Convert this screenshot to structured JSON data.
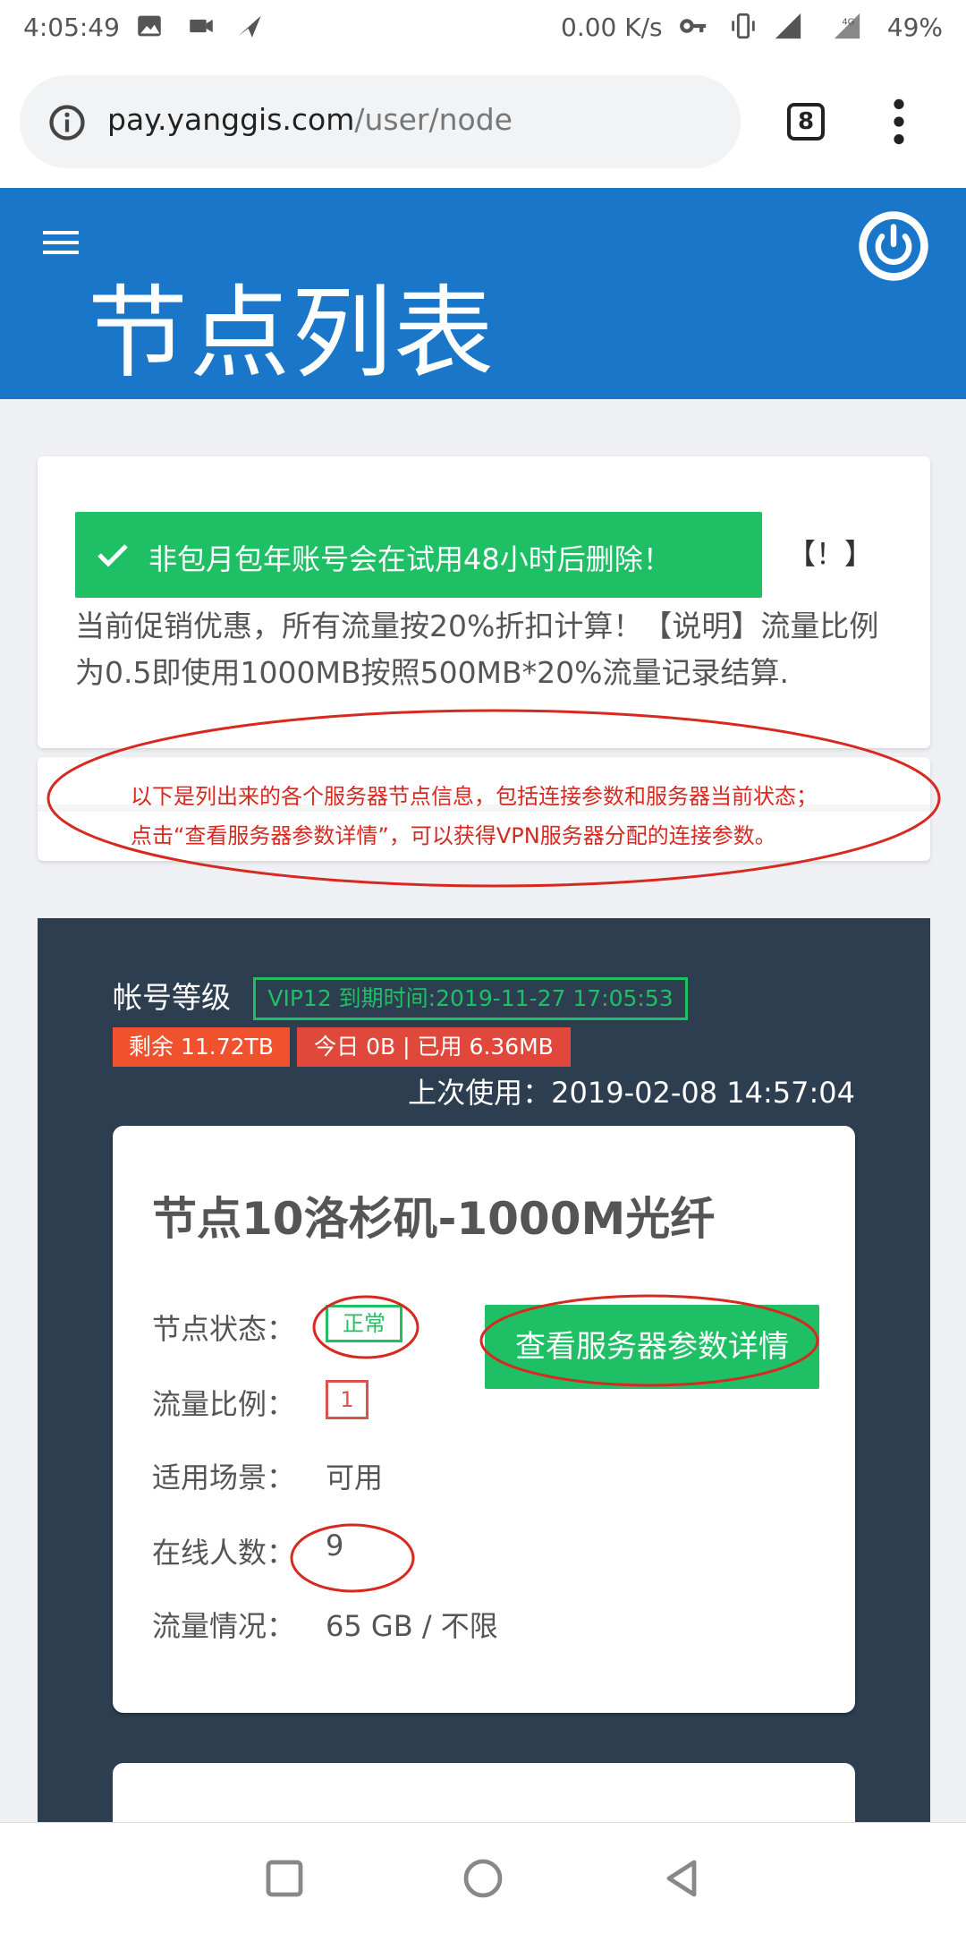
{
  "status_bar": {
    "time": "4:05:49",
    "net_speed": "0.00 K/s",
    "network_badge": "4G",
    "network_badge_sub": "1X",
    "battery": "49%",
    "icons": [
      "image-icon",
      "video-camera-icon",
      "send-icon",
      "key-icon",
      "vibrate-icon",
      "signal-icon",
      "signal-icon",
      "battery-icon"
    ]
  },
  "browser": {
    "url_host": "pay.yanggis.com",
    "url_path": "/user/node",
    "tab_count": "8"
  },
  "header": {
    "title": "节点列表"
  },
  "notice": {
    "alert": "非包月包年账号会在试用48小时后删除！",
    "exclaim": "【！】",
    "promo": "当前促销优惠，所有流量按20%折扣计算！【说明】流量比例为0.5即使用1000MB按照500MB*20%流量记录结算."
  },
  "info": {
    "line1": "以下是列出来的各个服务器节点信息，包括连接参数和服务器当前状态；",
    "line2": "点击“查看服务器参数详情”，可以获得VPN服务器分配的连接参数。"
  },
  "account": {
    "level_label": "帐号等级",
    "vip_badge": "VIP12 到期时间:2019-11-27 17:05:53",
    "remaining": "剩余 11.72TB",
    "usage": "今日 0B | 已用 6.36MB",
    "last_used": "上次使用：2019-02-08 14:57:04"
  },
  "node": {
    "title": "节点10洛杉矶-1000M光纤",
    "status_label": "节点状态：",
    "status_value": "正常",
    "ratio_label": "流量比例：",
    "ratio_value": "1",
    "scene_label": "适用场景：",
    "scene_value": "可用",
    "online_label": "在线人数：",
    "online_value": "9",
    "traffic_label": "流量情况：",
    "traffic_value": "65 GB / 不限",
    "detail_button": "查看服务器参数详情"
  },
  "colors": {
    "brand_blue": "#1976c9",
    "success_green": "#1fbf66",
    "danger_red": "#d9534f",
    "panel_dark": "#2c3e50",
    "annotation_red": "#d7291f"
  }
}
